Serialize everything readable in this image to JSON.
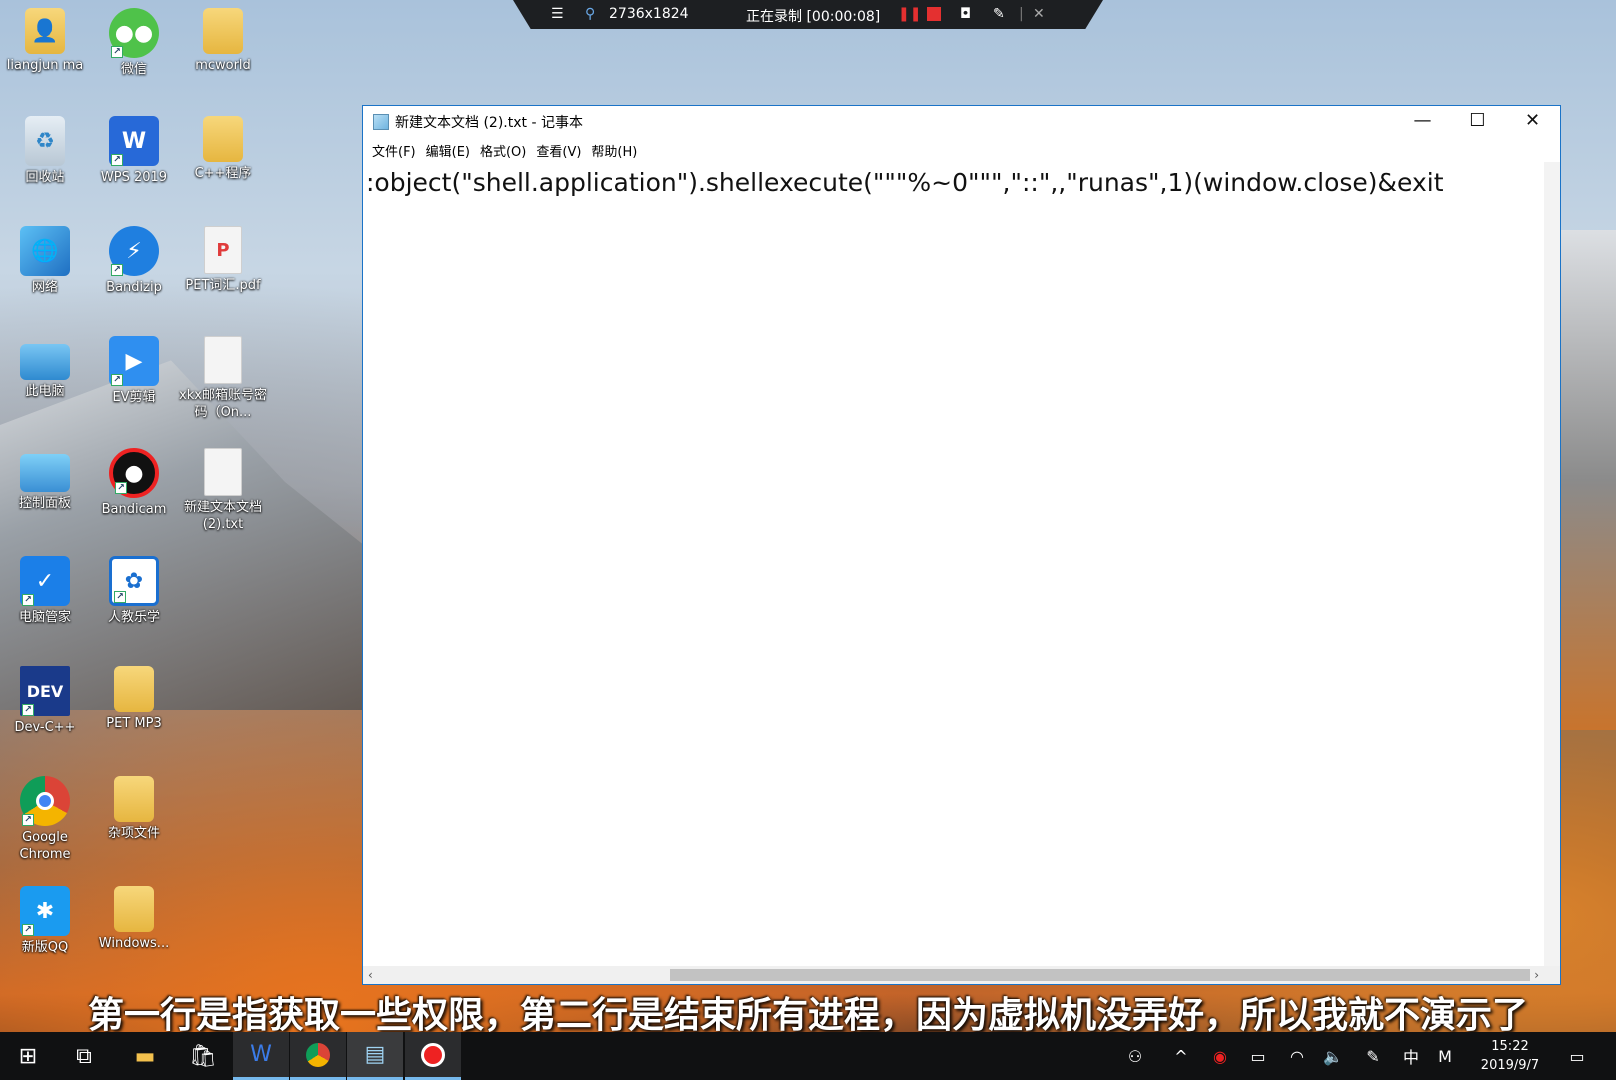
{
  "recorder": {
    "menu_icon": "hamburger-icon",
    "pin_icon": "pin-icon",
    "resolution": "2736x1824",
    "status": "正在录制 [00:00:08]",
    "pause_icon": "pause-icon",
    "stop_icon": "stop-icon",
    "camera_icon": "camera-icon",
    "pen_icon": "pen-icon",
    "close_icon": "close-icon"
  },
  "desktop_icons": [
    {
      "label": "liangjun ma",
      "icon": "user-folder-icon"
    },
    {
      "label": "微信",
      "icon": "wechat-icon"
    },
    {
      "label": "mcworld",
      "icon": "folder-icon"
    },
    {
      "label": "回收站",
      "icon": "recycle-bin-icon"
    },
    {
      "label": "WPS 2019",
      "icon": "wps-icon"
    },
    {
      "label": "C++程序",
      "icon": "folder-icon"
    },
    {
      "label": "网络",
      "icon": "network-icon"
    },
    {
      "label": "Bandizip",
      "icon": "bandizip-icon"
    },
    {
      "label": "PET词汇.pdf",
      "icon": "pdf-icon"
    },
    {
      "label": "此电脑",
      "icon": "computer-icon"
    },
    {
      "label": "EV剪辑",
      "icon": "ev-clip-icon"
    },
    {
      "label": "xkx邮箱账号密码（On...",
      "icon": "document-icon"
    },
    {
      "label": "控制面板",
      "icon": "control-panel-icon"
    },
    {
      "label": "Bandicam",
      "icon": "bandicam-icon"
    },
    {
      "label": "新建文本文档 (2).txt",
      "icon": "document-icon"
    },
    {
      "label": "电脑管家",
      "icon": "pc-manager-icon"
    },
    {
      "label": "人教乐学",
      "icon": "renjiao-icon"
    },
    {
      "label": "Dev-C++",
      "icon": "devcpp-icon"
    },
    {
      "label": "PET MP3",
      "icon": "folder-icon"
    },
    {
      "label": "Google Chrome",
      "icon": "chrome-icon"
    },
    {
      "label": "杂项文件",
      "icon": "folder-icon"
    },
    {
      "label": "新版QQ",
      "icon": "qq-icon"
    },
    {
      "label": "Windows...",
      "icon": "folder-icon"
    }
  ],
  "notepad": {
    "title": "新建文本文档 (2).txt - 记事本",
    "menus": [
      "文件(F)",
      "编辑(E)",
      "格式(O)",
      "查看(V)",
      "帮助(H)"
    ],
    "content": ":object(\"shell.application\").shellexecute(\"\"\"%~0\"\"\",\"::\",,\"runas\",1)(window.close)&exit"
  },
  "subtitle": "第一行是指获取一些权限，第二行是结束所有进程，因为虚拟机没弄好，所以我就不演示了",
  "taskbar": {
    "ime": "中",
    "ime2": "M",
    "time": "15:22",
    "date": "2019/9/7"
  }
}
